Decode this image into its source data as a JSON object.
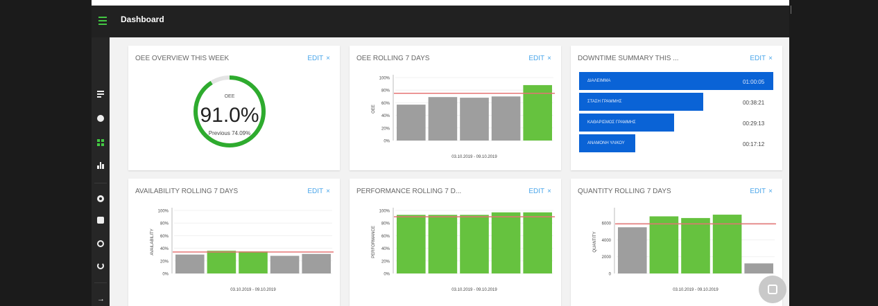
{
  "app": {
    "title": "Dashboard"
  },
  "sidebar": {
    "items": [
      {
        "icon": "list-icon"
      },
      {
        "icon": "record-icon"
      },
      {
        "icon": "dashboard-icon",
        "active": true
      },
      {
        "icon": "bar-chart-icon"
      },
      {
        "icon": "settings-icon"
      },
      {
        "icon": "chat-icon"
      },
      {
        "icon": "help-icon"
      },
      {
        "icon": "power-icon"
      },
      {
        "icon": "logout-arrow-icon"
      }
    ]
  },
  "edit_label": "EDIT",
  "edit_close": "×",
  "colors": {
    "green": "#66c23f",
    "gray": "#9e9e9e",
    "red_line": "#e57373",
    "blue": "#0a63d6",
    "accent": "#4aa6ea"
  },
  "cards": {
    "oee_overview": {
      "title": "OEE OVERVIEW THIS WEEK",
      "label": "OEE",
      "value": "91.0%",
      "previous": "Previous 74.09%",
      "fraction": 0.91
    },
    "oee_rolling": {
      "title": "OEE ROLLING 7 DAYS",
      "ylabel": "OEE",
      "range": "03.10.2019 - 09.10.2019"
    },
    "downtime": {
      "title": "DOWNTIME SUMMARY THIS ...",
      "rows": [
        {
          "label": "ΔΙΑΛΕΙΜΜΑ",
          "value": "01:00:05",
          "fraction": 1.0,
          "inside": true
        },
        {
          "label": "ΣΤΑΣΗ ΓΡΑΜΜΗΣ",
          "value": "00:38:21",
          "fraction": 0.64,
          "inside": false
        },
        {
          "label": "ΚΑΘΑΡΙΣΜΟΣ ΓΡΑΜΜΗΣ",
          "value": "00:29:13",
          "fraction": 0.49,
          "inside": false
        },
        {
          "label": "ΑΝΑΜΟΝΗ ΥΛΙΚΟΥ",
          "value": "00:17:12",
          "fraction": 0.29,
          "inside": false
        }
      ]
    },
    "availability": {
      "title": "AVAILABILITY ROLLING 7 DAYS",
      "ylabel": "AVAILABILITY",
      "range": "03.10.2019 - 09.10.2019"
    },
    "performance": {
      "title": "PERFORMANCE ROLLING 7 D...",
      "ylabel": "PERFORMANCE",
      "range": "03.10.2019 - 09.10.2019"
    },
    "quantity": {
      "title": "QUANTITY ROLLING 7 DAYS",
      "ylabel": "QUANTITY",
      "range": "03.10.2019 - 09.10.2019"
    }
  },
  "chart_data": [
    {
      "type": "bar",
      "id": "oee",
      "ylabel": "OEE",
      "xlabel": "03.10.2019 - 09.10.2019",
      "yticks": [
        "100%",
        "80%",
        "60%",
        "40%",
        "20%",
        "0%"
      ],
      "ylim": [
        0,
        100
      ],
      "values": [
        57,
        69,
        68,
        70,
        88
      ],
      "bar_colors": [
        "gray",
        "gray",
        "gray",
        "gray",
        "green"
      ],
      "target": 75
    },
    {
      "type": "bar",
      "id": "availability",
      "ylabel": "AVAILABILITY",
      "xlabel": "03.10.2019 - 09.10.2019",
      "yticks": [
        "100%",
        "80%",
        "60%",
        "40%",
        "20%",
        "0%"
      ],
      "ylim": [
        0,
        100
      ],
      "values": [
        30,
        36,
        35,
        28,
        31
      ],
      "bar_colors": [
        "gray",
        "green",
        "green",
        "gray",
        "gray"
      ],
      "target": 34
    },
    {
      "type": "bar",
      "id": "performance",
      "ylabel": "PERFORMANCE",
      "xlabel": "03.10.2019 - 09.10.2019",
      "yticks": [
        "100%",
        "80%",
        "60%",
        "40%",
        "20%",
        "0%"
      ],
      "ylim": [
        0,
        100
      ],
      "values": [
        93,
        93,
        93,
        97,
        97
      ],
      "bar_colors": [
        "green",
        "green",
        "green",
        "green",
        "green"
      ],
      "target": 90
    },
    {
      "type": "bar",
      "id": "quantity",
      "ylabel": "QUANTITY",
      "xlabel": "03.10.2019 - 09.10.2019",
      "yticks": [
        "6000",
        "4000",
        "2000",
        "0"
      ],
      "ylim": [
        0,
        7500
      ],
      "values": [
        5500,
        6800,
        6600,
        7000,
        1200
      ],
      "bar_colors": [
        "gray",
        "green",
        "green",
        "green",
        "gray"
      ],
      "target": 5900
    }
  ]
}
